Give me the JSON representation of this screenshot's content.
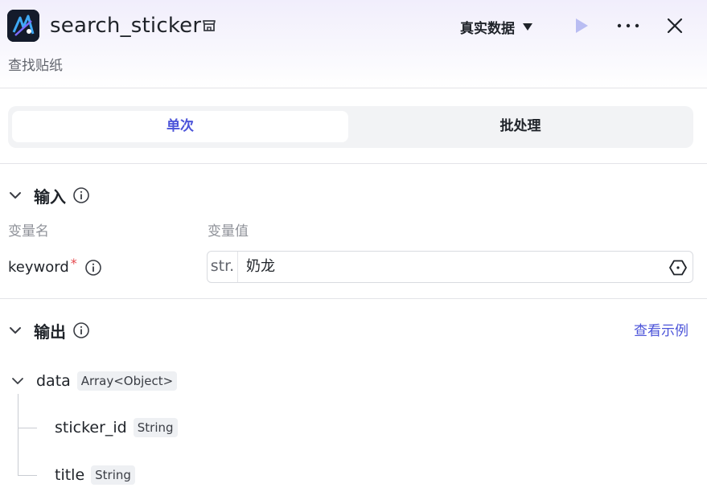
{
  "header": {
    "title": "search_sticker",
    "subtitle": "查找贴纸",
    "data_mode": "真实数据",
    "icons": {
      "app": "app-logo-icon",
      "tag": "store-tag-icon",
      "run": "play-icon",
      "more": "more-horizontal-icon",
      "close": "close-icon"
    }
  },
  "tabs": [
    {
      "label": "单次",
      "active": true
    },
    {
      "label": "批处理",
      "active": false
    }
  ],
  "input_section": {
    "title": "输入",
    "col_name": "变量名",
    "col_value": "变量值",
    "fields": [
      {
        "name": "keyword",
        "required_mark": "*",
        "type": "str.",
        "value": "奶龙"
      }
    ]
  },
  "output_section": {
    "title": "输出",
    "example_link": "查看示例",
    "tree": [
      {
        "name": "data",
        "type": "Array<Object>"
      },
      {
        "name": "sticker_id",
        "type": "String"
      },
      {
        "name": "title",
        "type": "String"
      }
    ]
  },
  "colors": {
    "accent": "#4c54d9",
    "required": "#e5484d",
    "text": "#1f2329",
    "muted": "#8f9299"
  }
}
